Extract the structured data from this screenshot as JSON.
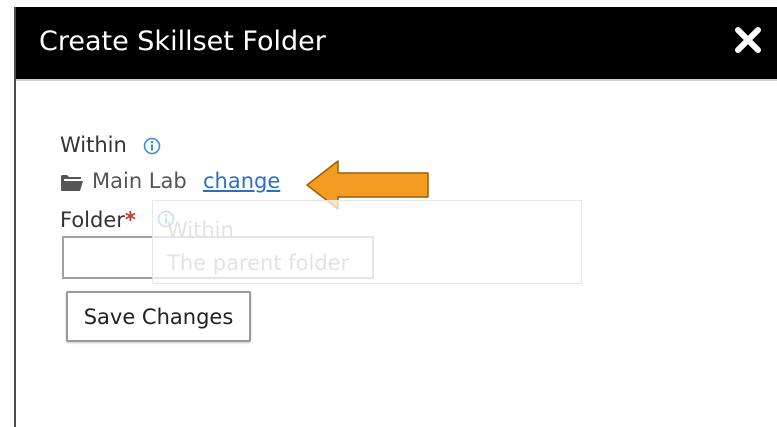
{
  "dialog": {
    "title": "Create Skillset Folder",
    "close_icon": "close-icon"
  },
  "within": {
    "label": "Within",
    "info_icon": "info-icon",
    "folder_icon": "folder-open-icon",
    "folder_name": "Main Lab",
    "change_link": "change"
  },
  "folder": {
    "label": "Folder",
    "required_marker": "*",
    "info_icon": "info-icon",
    "value": "",
    "placeholder": ""
  },
  "tooltip": {
    "title": "Within",
    "body": "The parent folder"
  },
  "actions": {
    "save_label": "Save Changes"
  },
  "annotation": {
    "arrow_color": "#f39c1f"
  },
  "colors": {
    "title_bar": "#000000",
    "link": "#2a6fc9",
    "info_icon": "#3a8fd9",
    "required": "#c0392b"
  }
}
